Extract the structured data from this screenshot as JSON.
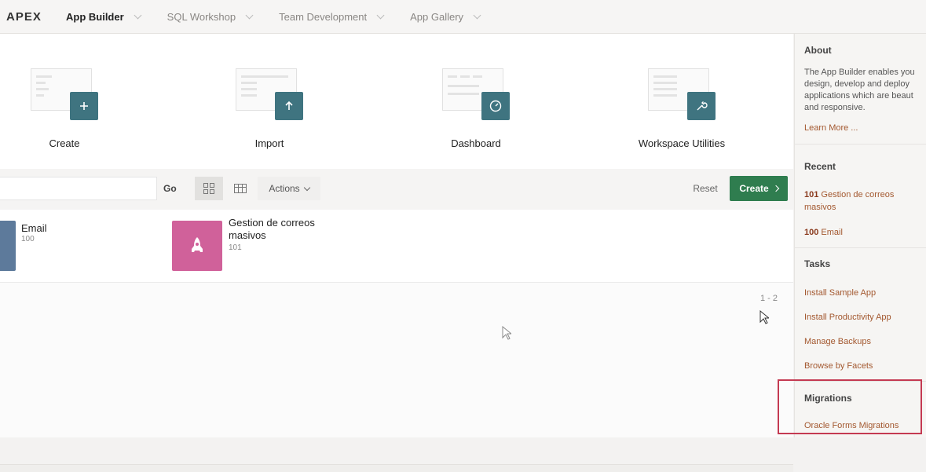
{
  "topbar": {
    "logo": "APEX",
    "nav": [
      {
        "label": "App Builder",
        "active": true
      },
      {
        "label": "SQL Workshop",
        "active": false
      },
      {
        "label": "Team Development",
        "active": false
      },
      {
        "label": "App Gallery",
        "active": false
      }
    ]
  },
  "tiles": [
    {
      "label": "Create",
      "icon": "plus-icon"
    },
    {
      "label": "Import",
      "icon": "arrow-up-icon"
    },
    {
      "label": "Dashboard",
      "icon": "gauge-icon"
    },
    {
      "label": "Workspace Utilities",
      "icon": "wrench-icon"
    }
  ],
  "toolbar": {
    "search_value": "",
    "go_label": "Go",
    "actions_label": "Actions",
    "reset_label": "Reset",
    "create_label": "Create"
  },
  "apps": [
    {
      "name": "Email",
      "number": "100",
      "color": "#5d7a9b"
    },
    {
      "name": "Gestion de correos masivos",
      "number": "101",
      "color": "#d0619a"
    }
  ],
  "pagination": "1 - 2",
  "sidebar": {
    "about": {
      "heading": "About",
      "text_lines": [
        "The App Builder enables you",
        "design, develop and deploy",
        "applications which are beaut",
        "and responsive."
      ],
      "learn_more": "Learn More ..."
    },
    "recent": {
      "heading": "Recent",
      "items": [
        {
          "id": "101",
          "name": "Gestion de correos masivos"
        },
        {
          "id": "100",
          "name": "Email"
        }
      ]
    },
    "tasks": {
      "heading": "Tasks",
      "items": [
        "Install Sample App",
        "Install Productivity App",
        "Manage Backups",
        "Browse by Facets"
      ]
    },
    "migrations": {
      "heading": "Migrations",
      "items": [
        "Oracle Forms Migrations"
      ]
    }
  },
  "colors": {
    "accent": "#3f7480",
    "create_button": "#2f7d4f",
    "link": "#a3582f",
    "highlight": "#c43a52"
  }
}
